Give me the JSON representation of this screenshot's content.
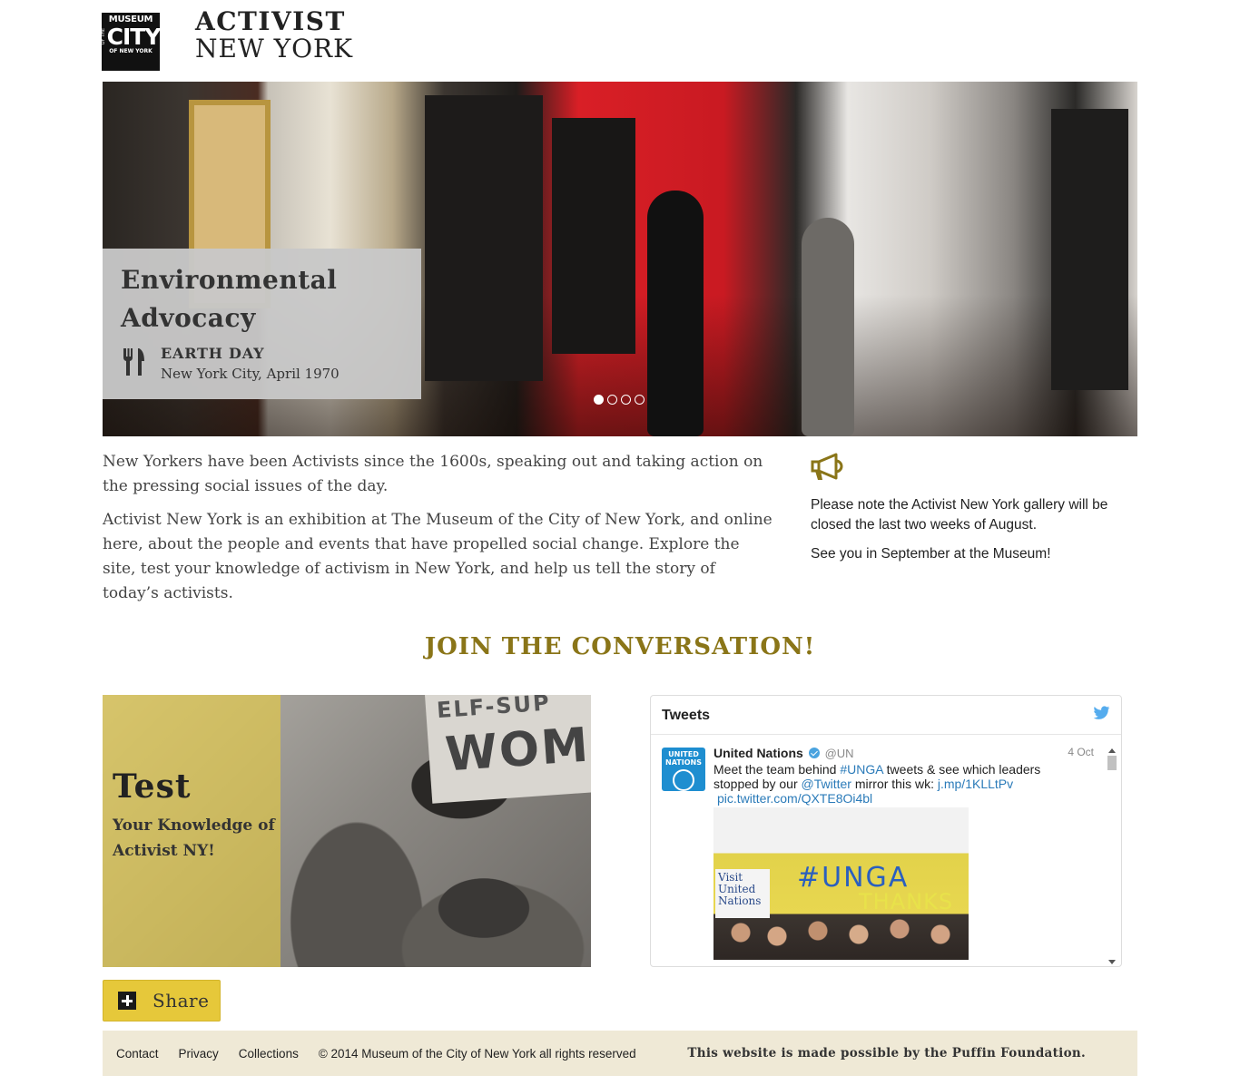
{
  "header": {
    "logo": {
      "line1": "MUSEUM",
      "of_the": "OF THE",
      "city": "CITY",
      "line3": "OF NEW YORK"
    },
    "title_line1": "ACTIVIST",
    "title_line2": "NEW YORK"
  },
  "hero": {
    "headline": "Environmental Advocacy",
    "event_name": "EARTH DAY",
    "event_place": "New York City, April 1970",
    "slide_count": 4,
    "active_slide": 1,
    "event_icon": "fork-knife-icon"
  },
  "intro": {
    "paragraph1": "New Yorkers have been Activists since the 1600s, speaking out and taking action on the pressing social issues of the day.",
    "paragraph2": "Activist New York is an exhibition at The Museum of the City of New York, and online here, about the people and events that have propelled social change. Explore the site, test your knowledge of activism in New York, and help us tell the story of today’s activists."
  },
  "notice": {
    "icon": "megaphone-icon",
    "line1": "Please note the Activist New York gallery will be closed the last two weeks of August.",
    "line2": "See you in September at the Museum!"
  },
  "join_heading": "JOIN THE CONVERSATION!",
  "quiz": {
    "title": "Test",
    "subtitle": "Your Knowledge of Activist NY!",
    "sign_top": "ELF-SUP",
    "sign_text": "WOM"
  },
  "tweets": {
    "heading": "Tweets",
    "tweet": {
      "avatar_text": "UNITED NATIONS",
      "author": "United Nations",
      "handle": "@UN",
      "date": "4 Oct",
      "text_before": "Meet the team behind ",
      "hashtag": "#UNGA",
      "text_mid": " tweets & see which leaders stopped by our ",
      "mention": "@Twitter",
      "text_after": " mirror this wk: ",
      "url": "j.mp/1KLLtPv",
      "pic_url": "pic.twitter.com/QXTE8Oi4bl",
      "media_hashtag": "#UNGA",
      "media_thanks": "THANKS",
      "media_poster": "Visit United Nations"
    }
  },
  "share": {
    "label": "Share"
  },
  "footer": {
    "links": [
      "Contact",
      "Privacy",
      "Collections"
    ],
    "copyright": "© 2014 Museum of the City of New York all rights reserved",
    "sponsor": "This website is made possible by the Puffin Foundation."
  },
  "colors": {
    "accent_gold": "#8a7518",
    "share_yellow": "#e6c83a",
    "footer_bg": "#efe9d6",
    "twitter_blue": "#4aa3df"
  }
}
